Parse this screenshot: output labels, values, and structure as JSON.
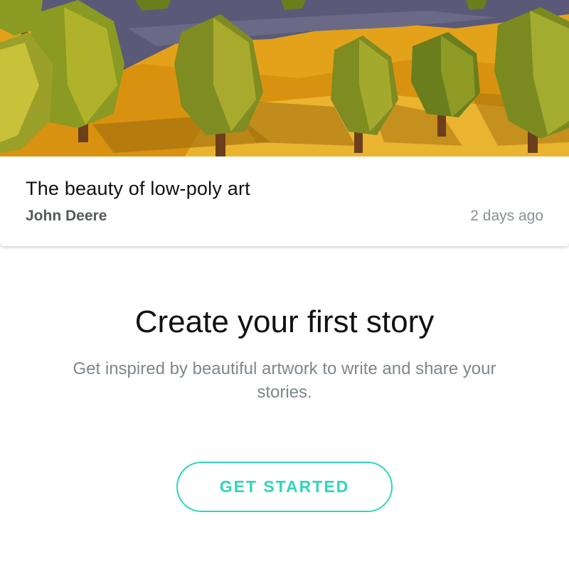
{
  "story_card": {
    "title": "The beauty of low-poly art",
    "author": "John Deere",
    "time": "2 days ago",
    "cover_description_icon": "low-poly-landscape-image"
  },
  "empty_state": {
    "title": "Create your first story",
    "subtitle": "Get inspired by beautiful artwork to write and share your stories.",
    "cta_label": "GET STARTED"
  },
  "colors": {
    "accent": "#2fd6b7",
    "title_text": "#111111",
    "muted_text": "#7e878b",
    "author_text": "#555a5c"
  }
}
